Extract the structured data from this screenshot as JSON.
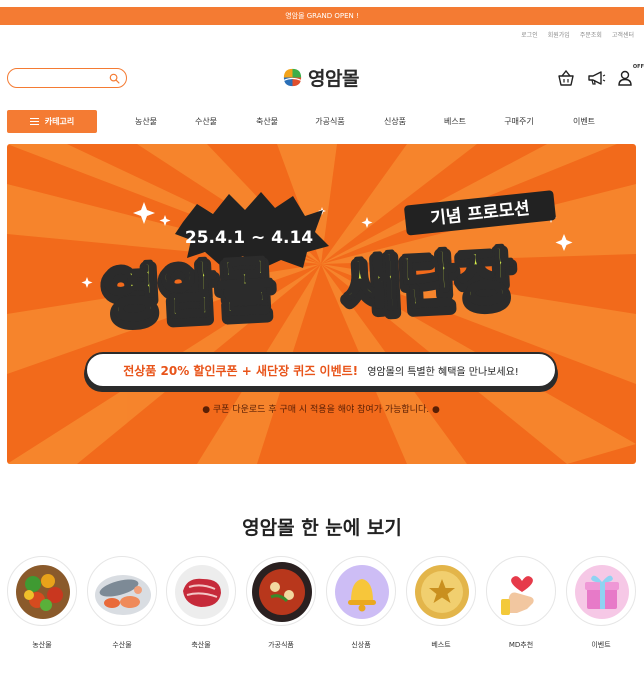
{
  "announcement": "영암몰 GRAND OPEN !",
  "util_links": [
    "로그인",
    "회원가입",
    "주문조회",
    "고객센터"
  ],
  "search": {
    "placeholder": ""
  },
  "logo": {
    "text": "영암몰"
  },
  "header_icons": {
    "cart": "basket-icon",
    "notice": "megaphone-icon",
    "user": "user-icon",
    "badge": "OFF"
  },
  "category_button": "카테고리",
  "nav": [
    "농산물",
    "수산물",
    "축산물",
    "가공식품",
    "신상품",
    "베스트",
    "구매주기",
    "이벤트"
  ],
  "banner": {
    "tag": "기념 프로모션",
    "date": "25.4.1 ~ 4.14",
    "headline_left": "영암몰",
    "headline_right": "새단장",
    "pill_strong": "전상품 20% 할인쿠폰 + 새단장 퀴즈 이벤트!",
    "pill_rest": "영암몰의 특별한 혜택을 만나보세요!",
    "note": "● 쿠폰 다운로드 후 구매 시 적용을 해야 참여가 가능합니다. ●"
  },
  "section_title": "영암몰 한 눈에 보기",
  "categories": [
    {
      "label": "농산물",
      "icon": "vegetables-icon"
    },
    {
      "label": "수산물",
      "icon": "seafood-icon"
    },
    {
      "label": "축산물",
      "icon": "meat-icon"
    },
    {
      "label": "가공식품",
      "icon": "stew-icon"
    },
    {
      "label": "신상품",
      "icon": "bell-icon"
    },
    {
      "label": "베스트",
      "icon": "star-medal-icon"
    },
    {
      "label": "MD추천",
      "icon": "heart-hand-icon"
    },
    {
      "label": "이벤트",
      "icon": "gift-icon"
    }
  ],
  "colors": {
    "accent": "#f47b33",
    "banner_bg": "#f26a1b",
    "headline": "#d6f04a",
    "dark": "#2b2b2b"
  }
}
